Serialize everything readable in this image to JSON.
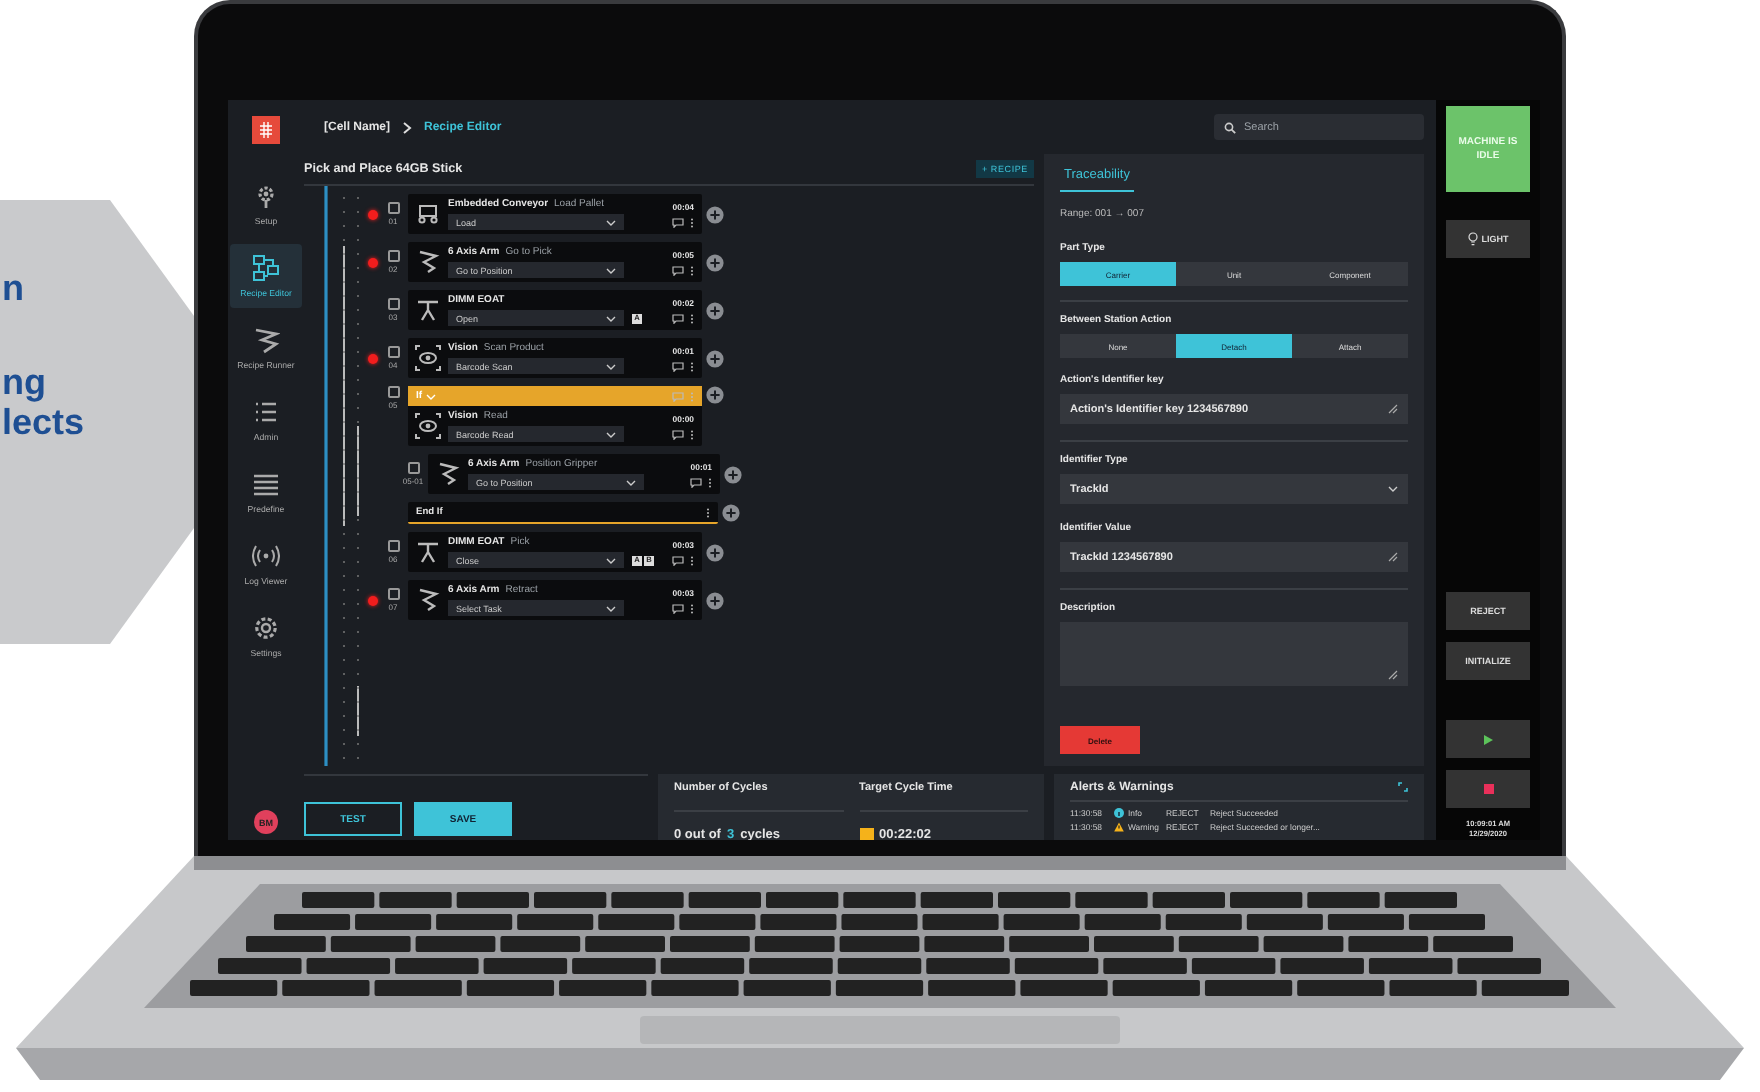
{
  "banner": {
    "lines": [
      "n",
      "ng",
      "lects"
    ]
  },
  "nav": {
    "items": [
      {
        "label": "Setup",
        "selected": false
      },
      {
        "label": "Recipe Editor",
        "selected": true
      },
      {
        "label": "Recipe Runner",
        "selected": false
      },
      {
        "label": "Admin",
        "selected": false
      },
      {
        "label": "Predefine",
        "selected": false
      },
      {
        "label": "Log Viewer",
        "selected": false
      },
      {
        "label": "Settings",
        "selected": false
      }
    ],
    "user": {
      "initials": "BM"
    }
  },
  "header": {
    "breadcrumb": [
      "[Cell Name]",
      "Recipe Editor"
    ],
    "search": {
      "placeholder": "Search"
    }
  },
  "recipe": {
    "title": "Pick and Place 64GB Stick",
    "add_button": "+ RECIPE",
    "steps": [
      {
        "kind": "conveyor",
        "number": "01",
        "alarm": true,
        "checked": false,
        "device": "Embedded Conveyor",
        "action": "Load Pallet",
        "task": "Load",
        "time": "00:04"
      },
      {
        "kind": "arm",
        "number": "02",
        "alarm": true,
        "checked": false,
        "device": "6 Axis Arm",
        "action": "Go to Pick",
        "task": "Go to Position",
        "time": "00:05"
      },
      {
        "kind": "gripper",
        "number": "03",
        "alarm": false,
        "checked": false,
        "device": "DIMM EOAT",
        "task": "Open",
        "time": "00:02",
        "tags": [
          "A"
        ]
      },
      {
        "kind": "vision",
        "number": "04",
        "alarm": true,
        "checked": false,
        "device": "Vision",
        "action": "Scan Product",
        "task": "Barcode Scan",
        "time": "00:01"
      },
      {
        "kind": "if",
        "number": "05",
        "alarm": false,
        "checked": false,
        "label": "If",
        "children": [
          {
            "kind": "vision",
            "device": "Vision",
            "action": "Read",
            "task": "Barcode Read",
            "time": "00:00"
          },
          {
            "kind": "arm",
            "number": "05-01",
            "checked": false,
            "device": "6 Axis Arm",
            "action": "Position Gripper",
            "task": "Go to Position",
            "time": "00:01"
          }
        ]
      },
      {
        "kind": "end_if",
        "label": "End If"
      },
      {
        "kind": "gripper",
        "number": "06",
        "alarm": false,
        "checked": false,
        "device": "DIMM EOAT",
        "action": "Pick",
        "task": "Close",
        "time": "00:03",
        "tags": [
          "A",
          "B"
        ]
      },
      {
        "kind": "arm",
        "number": "07",
        "alarm": true,
        "checked": false,
        "device": "6 Axis Arm",
        "action": "Retract",
        "task": "Select Task",
        "time": "00:03"
      }
    ]
  },
  "panel": {
    "tabs": [
      {
        "label": "Traceability",
        "selected": true
      }
    ],
    "range": "Range: 001 → 007",
    "part_type": {
      "label": "Part Type",
      "options": [
        {
          "label": "Carrier",
          "selected": true
        },
        {
          "label": "Unit",
          "selected": false
        },
        {
          "label": "Component",
          "selected": false
        }
      ]
    },
    "station_action": {
      "label": "Between Station Action",
      "options": [
        {
          "label": "None",
          "selected": false
        },
        {
          "label": "Detach",
          "selected": true
        },
        {
          "label": "Attach",
          "selected": false
        }
      ]
    },
    "fields": [
      {
        "kind": "textarea",
        "label": "Action's Identifier key",
        "value": "Action's Identifier key 1234567890"
      },
      {
        "kind": "select",
        "label": "Identifier Type",
        "value": "TrackId"
      },
      {
        "kind": "textarea",
        "label": "Identifier Value",
        "value": "TrackId 1234567890"
      },
      {
        "kind": "textarea",
        "label": "Description"
      }
    ],
    "delete_button": "Delete"
  },
  "machine": {
    "status": "MACHINE IS IDLE",
    "light_button": "LIGHT",
    "actions": [
      "REJECT",
      "INITIALIZE"
    ],
    "run_buttons": [
      {
        "kind": "play"
      },
      {
        "kind": "stop"
      }
    ],
    "clock": {
      "time": "10:09:01 AM",
      "date": "12/29/2020"
    }
  },
  "footer": {
    "buttons": [
      {
        "kind": "outline",
        "label": "TEST"
      },
      {
        "kind": "filled",
        "label": "SAVE"
      }
    ],
    "cycles": {
      "heading": "Number of Cycles",
      "prefix": "0 out of",
      "count": "3",
      "suffix": "cycles"
    },
    "target": {
      "heading": "Target Cycle Time",
      "value": "00:22:02"
    },
    "alerts": {
      "title": "Alerts & Warnings",
      "rows": [
        {
          "kind": "info",
          "time": "11:30:58",
          "level": "Info",
          "source": "REJECT",
          "message": "Reject Succeeded"
        },
        {
          "kind": "warning",
          "time": "11:30:58",
          "level": "Warning",
          "source": "REJECT",
          "message": "Reject Succeeded or longer..."
        }
      ]
    }
  }
}
